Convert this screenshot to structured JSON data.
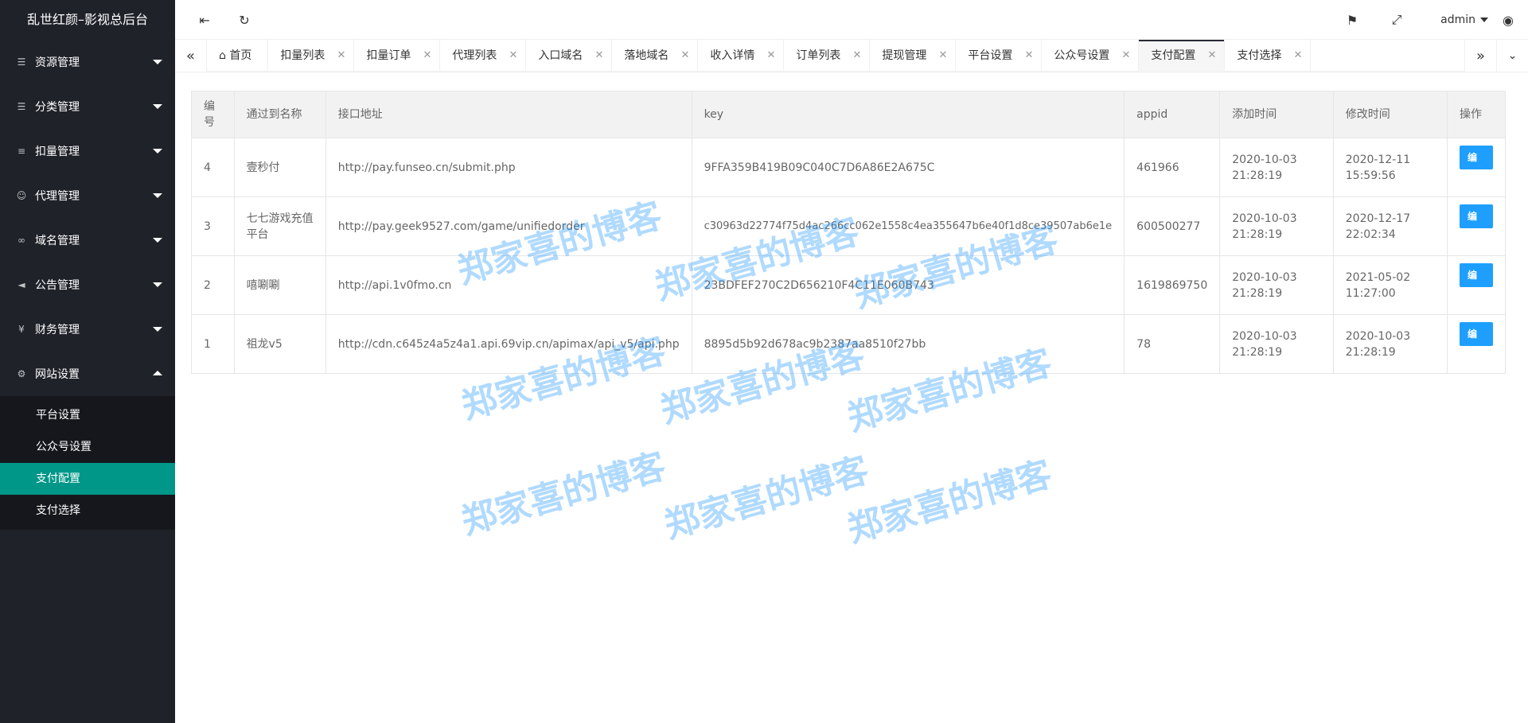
{
  "app": {
    "title": "乱世红颜–影视总后台"
  },
  "sidebar": {
    "groups": [
      {
        "label": "资源管理",
        "icon": "layers-icon"
      },
      {
        "label": "分类管理",
        "icon": "layers-icon"
      },
      {
        "label": "扣量管理",
        "icon": "list-indent-icon"
      },
      {
        "label": "代理管理",
        "icon": "user-icon"
      },
      {
        "label": "域名管理",
        "icon": "link-icon"
      },
      {
        "label": "公告管理",
        "icon": "speaker-icon"
      },
      {
        "label": "财务管理",
        "icon": "yen-icon"
      },
      {
        "label": "网站设置",
        "icon": "gear-icon"
      }
    ],
    "subitems": [
      {
        "label": "平台设置"
      },
      {
        "label": "公众号设置"
      },
      {
        "label": "支付配置"
      },
      {
        "label": "支付选择"
      }
    ]
  },
  "topbar": {
    "user": "admin"
  },
  "tabs": [
    {
      "label": "首页"
    },
    {
      "label": "扣量列表"
    },
    {
      "label": "扣量订单"
    },
    {
      "label": "代理列表"
    },
    {
      "label": "入口域名"
    },
    {
      "label": "落地域名"
    },
    {
      "label": "收入详情"
    },
    {
      "label": "订单列表"
    },
    {
      "label": "提现管理"
    },
    {
      "label": "平台设置"
    },
    {
      "label": "公众号设置"
    },
    {
      "label": "支付配置"
    },
    {
      "label": "支付选择"
    }
  ],
  "table": {
    "headers": [
      "编号",
      "通过到名称",
      "接口地址",
      "key",
      "appid",
      "添加时间",
      "修改时间",
      "操作"
    ],
    "edit_label": "编辑",
    "rows": [
      {
        "id": "4",
        "name": "壹秒付",
        "url": "http://pay.funseo.cn/submit.php",
        "key": "9FFA359B419B09C040C7D6A86E2A675C",
        "appid": "461966",
        "added": "2020-10-03 21:28:19",
        "modified": "2020-12-11 15:59:56"
      },
      {
        "id": "3",
        "name": "七七游戏充值平台",
        "url": "http://pay.geek9527.com/game/unifiedorder",
        "key": "c30963d22774f75d4ac266cc062e1558c4ea355647b6e40f1d8ce39507ab6e1e",
        "appid": "600500277",
        "added": "2020-10-03 21:28:19",
        "modified": "2020-12-17 22:02:34"
      },
      {
        "id": "2",
        "name": "嘻唰唰",
        "url": "http://api.1v0fmo.cn",
        "key": "23BDFEF270C2D656210F4C11E060B743",
        "appid": "1619869750",
        "added": "2020-10-03 21:28:19",
        "modified": "2021-05-02 11:27:00"
      },
      {
        "id": "1",
        "name": "祖龙v5",
        "url": "http://cdn.c645z4a5z4a1.api.69vip.cn/apimax/api_v5/api.php",
        "key": "8895d5b92d678ac9b2387aa8510f27bb",
        "appid": "78",
        "added": "2020-10-03 21:28:19",
        "modified": "2020-10-03 21:28:19"
      }
    ]
  },
  "watermark": {
    "text": "郑家喜的博客"
  }
}
